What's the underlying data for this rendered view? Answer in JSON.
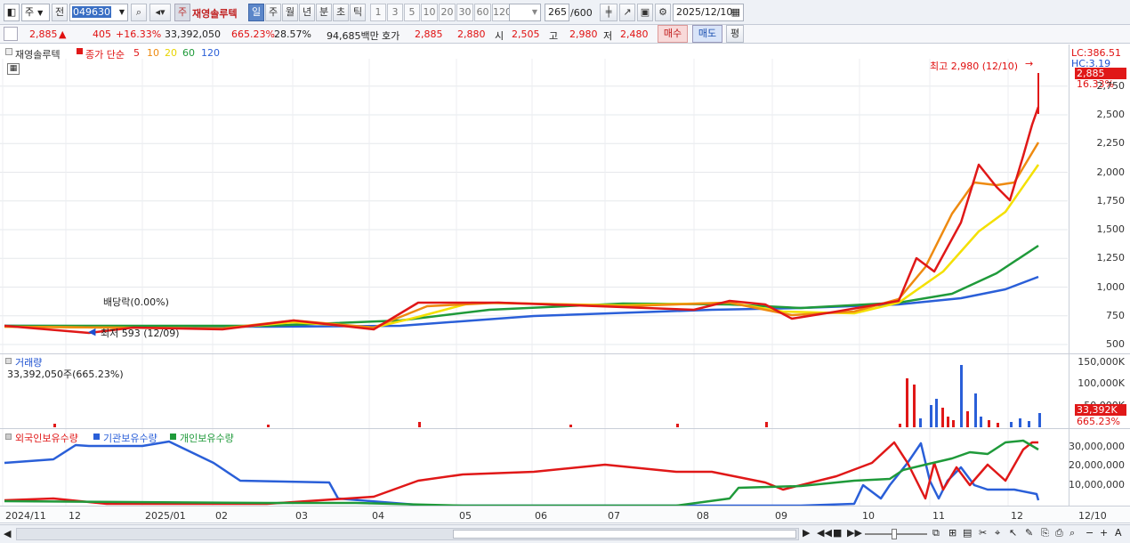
{
  "toolbar": {
    "market": "주",
    "prev_btn": "전",
    "code": "049630",
    "stock_badge": "주",
    "stock_name": "재영솔루텍",
    "periods": [
      "일",
      "주",
      "월",
      "년",
      "분",
      "초",
      "틱"
    ],
    "active_period": "일",
    "intervals": [
      "1",
      "3",
      "5",
      "10",
      "20",
      "30",
      "60",
      "120"
    ],
    "count": "265",
    "count_max": "/600",
    "date": "2025/12/10"
  },
  "quote": {
    "price": "2,885",
    "change_arrow": "▲",
    "change": "405",
    "change_pct": "+16.33%",
    "volume": "33,392,050",
    "volume_ratio": "665.23%",
    "turnover": "28.57%",
    "amount": "94,685백만",
    "ask_label": "호가",
    "ask1": "2,885",
    "ask2": "2,880",
    "open_label": "시",
    "open": "2,505",
    "high_label": "고",
    "high": "2,980",
    "low_label": "저",
    "low": "2,480",
    "buy_btn": "매수",
    "sell_btn": "매도",
    "balance_btn": "평"
  },
  "price_pane": {
    "legend_name": "재영솔루텍",
    "legend_ma_label": "종가 단순",
    "ma_periods": [
      "5",
      "10",
      "20",
      "60",
      "120"
    ],
    "ma_colors": [
      "#e01818",
      "#ee8a10",
      "#f4e000",
      "#1f9a3a",
      "#2a5fd8"
    ],
    "lc": "LC:386.51",
    "hc": "HC:3.19",
    "current_price_tag": "2,885",
    "current_pct_tag": "16.33%",
    "high_marker": "최고 2,980 (12/10)",
    "low_marker": "최저 593 (12/09)",
    "dividend_marker": "배당락(0.00%)",
    "y_ticks": [
      "2,750",
      "2,500",
      "2,250",
      "2,000",
      "1,750",
      "1,500",
      "1,250",
      "1,000",
      "750",
      "500"
    ]
  },
  "volume_pane": {
    "title": "거래량",
    "value": "33,392,050주(665.23%)",
    "y_ticks": [
      "150,000K",
      "100,000K",
      "50,000K"
    ],
    "current_tag": "33,392K",
    "current_pct_tag": "665.23%"
  },
  "holdings_pane": {
    "legend": [
      "외국인보유수량",
      "기관보유수량",
      "개인보유수량"
    ],
    "legend_colors": [
      "#e01818",
      "#2a5fd8",
      "#1f9a3a"
    ],
    "y_ticks": [
      "30,000,000",
      "20,000,000",
      "10,000,000"
    ]
  },
  "x_axis": {
    "labels": [
      "2024/11",
      "12",
      "2025/01",
      "02",
      "03",
      "04",
      "05",
      "06",
      "07",
      "08",
      "09",
      "10",
      "11",
      "12"
    ],
    "right_label": "12/10"
  }
}
